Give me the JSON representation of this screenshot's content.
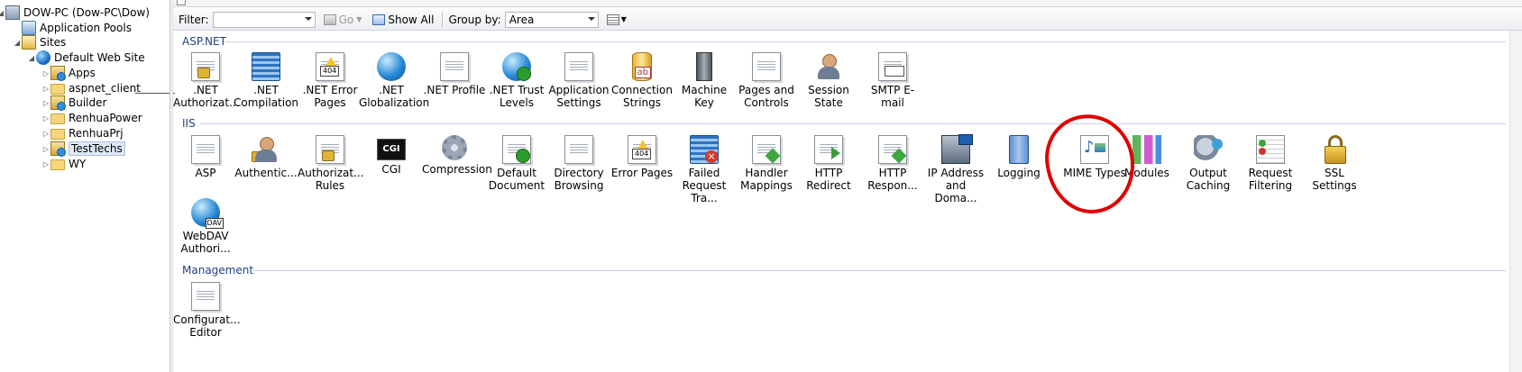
{
  "tree": {
    "server": "DOW-PC (Dow-PC\\Dow)",
    "app_pools": "Application Pools",
    "sites": "Sites",
    "default_site": "Default Web Site",
    "children": [
      "Apps",
      "aspnet_client",
      "Builder",
      "RenhuaPower",
      "RenhuaPrj",
      "TestTechs",
      "WY"
    ],
    "selected": "TestTechs"
  },
  "toolbar": {
    "filter_label": "Filter:",
    "filter_value": "",
    "go_label": "Go",
    "show_all_label": "Show All",
    "group_by_label": "Group by:",
    "group_by_value": "Area"
  },
  "groups": {
    "aspnet": {
      "title": "ASP.NET",
      "items": [
        {
          "label": ".NET Authorizat...",
          "icon": "lock-doc-icon"
        },
        {
          "label": ".NET Compilation",
          "icon": "stack-arrow-icon"
        },
        {
          "label": ".NET Error Pages",
          "icon": "warning-404-icon"
        },
        {
          "label": ".NET Globalization",
          "icon": "globe-icon"
        },
        {
          "label": ".NET Profile",
          "icon": "profile-doc-icon"
        },
        {
          "label": ".NET Trust Levels",
          "icon": "globe-check-icon"
        },
        {
          "label": "Application Settings",
          "icon": "settings-list-icon"
        },
        {
          "label": "Connection Strings",
          "icon": "database-icon"
        },
        {
          "label": "Machine Key",
          "icon": "server-key-icon"
        },
        {
          "label": "Pages and Controls",
          "icon": "pages-icon"
        },
        {
          "label": "Session State",
          "icon": "person-icon"
        },
        {
          "label": "SMTP E-mail",
          "icon": "mail-icon"
        }
      ]
    },
    "iis": {
      "title": "IIS",
      "items": [
        {
          "label": "ASP",
          "icon": "gear-doc-icon"
        },
        {
          "label": "Authentic...",
          "icon": "person-lock-icon"
        },
        {
          "label": "Authorizat... Rules",
          "icon": "lock-doc-icon"
        },
        {
          "label": "CGI",
          "icon": "cgi-icon"
        },
        {
          "label": "Compression",
          "icon": "clamp-icon"
        },
        {
          "label": "Default Document",
          "icon": "doc-check-icon"
        },
        {
          "label": "Directory Browsing",
          "icon": "window-icon"
        },
        {
          "label": "Error Pages",
          "icon": "warning-404-icon"
        },
        {
          "label": "Failed Request Tra...",
          "icon": "stack-error-icon"
        },
        {
          "label": "Handler Mappings",
          "icon": "handler-icon"
        },
        {
          "label": "HTTP Redirect",
          "icon": "redirect-icon"
        },
        {
          "label": "HTTP Respon...",
          "icon": "response-icon"
        },
        {
          "label": "IP Address and Doma...",
          "icon": "network-pc-icon"
        },
        {
          "label": "Logging",
          "icon": "book-icon"
        },
        {
          "label": "MIME Types",
          "icon": "music-icon"
        },
        {
          "label": "Modules",
          "icon": "bars-icon"
        },
        {
          "label": "Output Caching",
          "icon": "gears-icon"
        },
        {
          "label": "Request Filtering",
          "icon": "filter-icon"
        },
        {
          "label": "SSL Settings",
          "icon": "padlock-icon"
        },
        {
          "label": "WebDAV Authori...",
          "icon": "webdav-icon"
        }
      ]
    },
    "management": {
      "title": "Management",
      "items": [
        {
          "label": "Configurat... Editor",
          "icon": "config-doc-icon"
        }
      ]
    }
  },
  "annotation": {
    "color": "#e00000",
    "target": "MIME Types"
  }
}
